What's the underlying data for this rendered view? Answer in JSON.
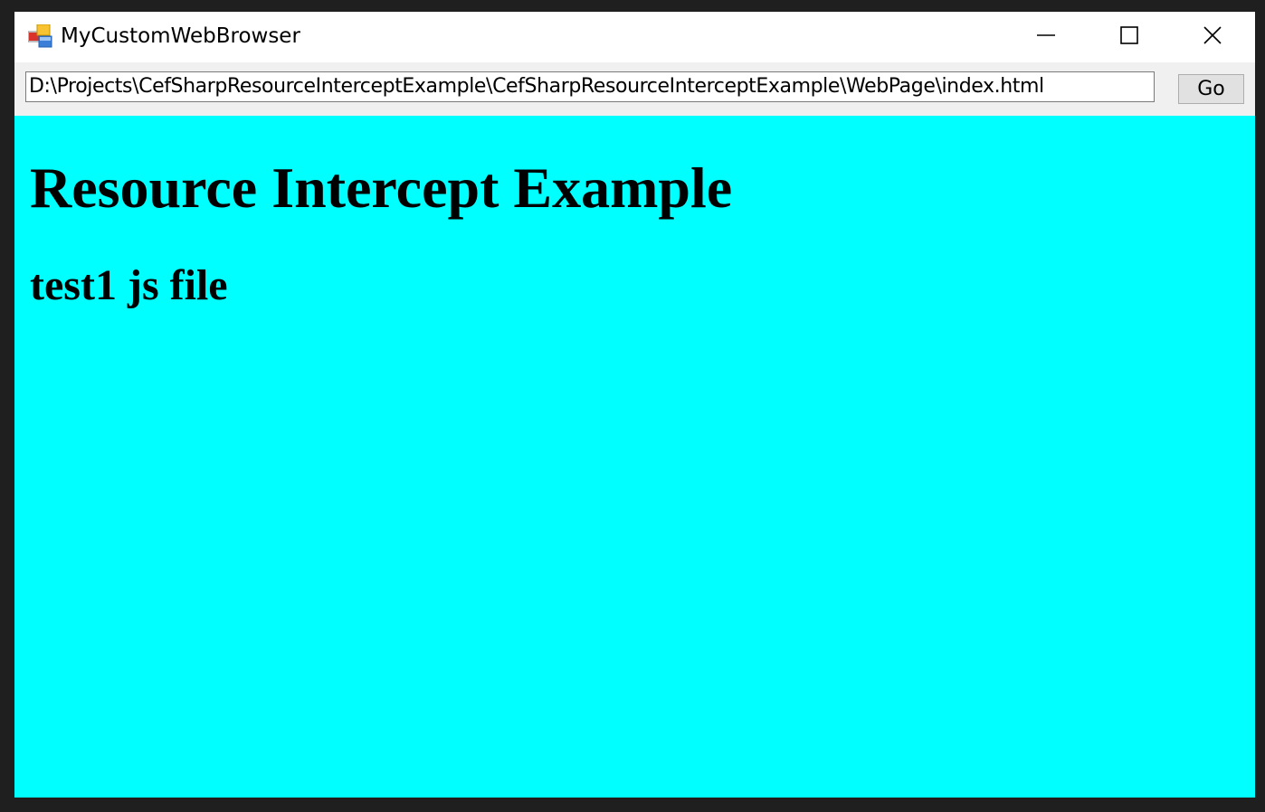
{
  "window": {
    "title": "MyCustomWebBrowser",
    "icon": "app-window-icon",
    "controls": {
      "minimize": "minimize-icon",
      "maximize": "maximize-icon",
      "close": "close-icon"
    }
  },
  "toolbar": {
    "address_value": "D:\\Projects\\CefSharpResourceInterceptExample\\CefSharpResourceInterceptExample\\WebPage\\index.html",
    "go_label": "Go"
  },
  "page": {
    "background": "#00ffff",
    "heading": "Resource Intercept Example",
    "subheading": "test1 js file"
  }
}
